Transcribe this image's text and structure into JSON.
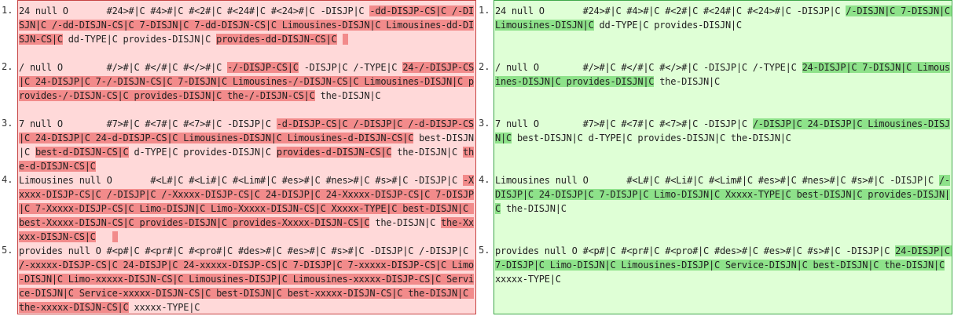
{
  "left": {
    "rows": [
      {
        "num": "1.",
        "segments": [
          {
            "t": "24 null O       #24>#|C #4>#|C #<2#|C #<24#|C #<24>#|C -DISJP|C ",
            "h": false
          },
          {
            "t": "-dd-DISJP-CS|C /-DISJN|C /-dd-DISJN-CS|C 7-DISJN|C 7-dd-DISJN-CS|C Limousines-DISJN|C Limousines-dd-DISJN-CS|C",
            "h": true
          },
          {
            "t": " dd-TYPE|C provides-DISJN|C ",
            "h": false
          },
          {
            "t": "provides-dd-DISJN-CS|C",
            "h": true
          },
          {
            "t": " ",
            "h": false
          },
          {
            "t": " ",
            "h": true
          }
        ]
      },
      {
        "num": "2.",
        "segments": [
          {
            "t": "/ null O        #/>#|C #</#|C #</>#|C ",
            "h": false
          },
          {
            "t": "-/-DISJP-CS|C",
            "h": true
          },
          {
            "t": " -DISJP|C /-TYPE|C ",
            "h": false
          },
          {
            "t": "24-/-DISJP-CS|C 24-DISJP|C 7-/-DISJN-CS|C 7-DISJN|C Limousines-/-DISJN-CS|C Limousines-DISJN|C provides-/-DISJN-CS|C provides-DISJN|C the-/-DISJN-CS|C",
            "h": true
          },
          {
            "t": " the-DISJN|C",
            "h": false
          }
        ]
      },
      {
        "num": "3.",
        "segments": [
          {
            "t": "7 null O        #7>#|C #<7#|C #<7>#|C -DISJP|C ",
            "h": false
          },
          {
            "t": "-d-DISJP-CS|C /-DISJP|C /-d-DISJP-CS|C 24-DISJP|C 24-d-DISJP-CS|C Limousines-DISJN|C Limousines-d-DISJN-CS|C",
            "h": true
          },
          {
            "t": " best-DISJN|C ",
            "h": false
          },
          {
            "t": "best-d-DISJN-CS|C",
            "h": true
          },
          {
            "t": " d-TYPE|C provides-DISJN|C ",
            "h": false
          },
          {
            "t": "provides-d-DISJN-CS|C",
            "h": true
          },
          {
            "t": " the-DISJN|C ",
            "h": false
          },
          {
            "t": "the-d-DISJN-CS|C",
            "h": true
          }
        ]
      },
      {
        "num": "4.",
        "segments": [
          {
            "t": "Limousines null O       #<L#|C #<Li#|C #<Lim#|C #es>#|C #nes>#|C #s>#|C -DISJP|C ",
            "h": false
          },
          {
            "t": "-Xxxxx-DISJP-CS|C /-DISJP|C /-Xxxxx-DISJP-CS|C 24-DISJP|C 24-Xxxxx-DISJP-CS|C 7-DISJP|C 7-Xxxxx-DISJP-CS|C Limo-DISJN|C Limo-Xxxxx-DISJN-CS|C Xxxxx-TYPE|C best-DISJN|C best-Xxxxx-DISJN-CS|C provides-DISJN|C provides-Xxxxx-DISJN-CS|C",
            "h": true
          },
          {
            "t": " the-DISJN|C ",
            "h": false
          },
          {
            "t": "the-Xxxxx-DISJN-CS|C",
            "h": true
          },
          {
            "t": "   ",
            "h": false
          },
          {
            "t": " ",
            "h": true
          }
        ]
      },
      {
        "num": "5.",
        "segments": [
          {
            "t": "provides null O #<p#|C #<pr#|C #<pro#|C #des>#|C #es>#|C #s>#|C -DISJP|C /-DISJP|C ",
            "h": false
          },
          {
            "t": "/-xxxxx-DISJP-CS|C 24-DISJP|C 24-xxxxx-DISJP-CS|C 7-DISJP|C 7-xxxxx-DISJP-CS|C Limo-DISJN|C Limo-xxxxx-DISJN-CS|C Limousines-DISJP|C Limousines-xxxxx-DISJP-CS|C Service-DISJN|C Service-xxxxx-DISJN-CS|C best-DISJN|C best-xxxxx-DISJN-CS|C the-DISJN|C the-xxxxx-DISJN-CS|C",
            "h": true
          },
          {
            "t": " xxxxx-TYPE|C",
            "h": false
          }
        ]
      }
    ]
  },
  "right": {
    "rows": [
      {
        "num": "1.",
        "segments": [
          {
            "t": "24 null O       #24>#|C #4>#|C #<2#|C #<24#|C #<24>#|C -DISJP|C ",
            "h": false
          },
          {
            "t": "/-DISJN|C 7-DISJN|C Limousines-DISJN|C",
            "h": true
          },
          {
            "t": " dd-TYPE|C provides-DISJN|C",
            "h": false
          }
        ]
      },
      {
        "num": "2.",
        "segments": [
          {
            "t": "/ null O        #/>#|C #</#|C #</>#|C -DISJP|C /-TYPE|C ",
            "h": false
          },
          {
            "t": "24-DISJP|C 7-DISJN|C Limousines-DISJN|C provides-DISJN|C",
            "h": true
          },
          {
            "t": " the-DISJN|C",
            "h": false
          }
        ]
      },
      {
        "num": "3.",
        "segments": [
          {
            "t": "7 null O        #7>#|C #<7#|C #<7>#|C -DISJP|C ",
            "h": false
          },
          {
            "t": "/-DISJP|C 24-DISJP|C Limousines-DISJN|C",
            "h": true
          },
          {
            "t": " best-DISJN|C d-TYPE|C provides-DISJN|C the-DISJN|C",
            "h": false
          }
        ]
      },
      {
        "num": "4.",
        "segments": [
          {
            "t": "Limousines null O       #<L#|C #<Li#|C #<Lim#|C #es>#|C #nes>#|C #s>#|C -DISJP|C ",
            "h": false
          },
          {
            "t": "/-DISJP|C 24-DISJP|C 7-DISJP|C Limo-DISJN|C Xxxxx-TYPE|C best-DISJN|C provides-DISJN|C",
            "h": true
          },
          {
            "t": " the-DISJN|C",
            "h": false
          }
        ]
      },
      {
        "num": "5.",
        "segments": [
          {
            "t": "provides null O #<p#|C #<pr#|C #<pro#|C #des>#|C #es>#|C #s>#|C -DISJP|C ",
            "h": false
          },
          {
            "t": "24-DISJP|C 7-DISJP|C Limo-DISJN|C Limousines-DISJP|C Service-DISJN|C best-DISJN|C the-DISJN|C",
            "h": true
          },
          {
            "t": " xxxxx-TYPE|C",
            "h": false
          }
        ]
      }
    ]
  },
  "colors": {
    "left_bg": "#ffd9d9",
    "left_highlight": "#f28b8b",
    "left_border": "#c74444",
    "right_bg": "#dfffd6",
    "right_highlight": "#8ee28a",
    "right_border": "#3fa84a"
  }
}
